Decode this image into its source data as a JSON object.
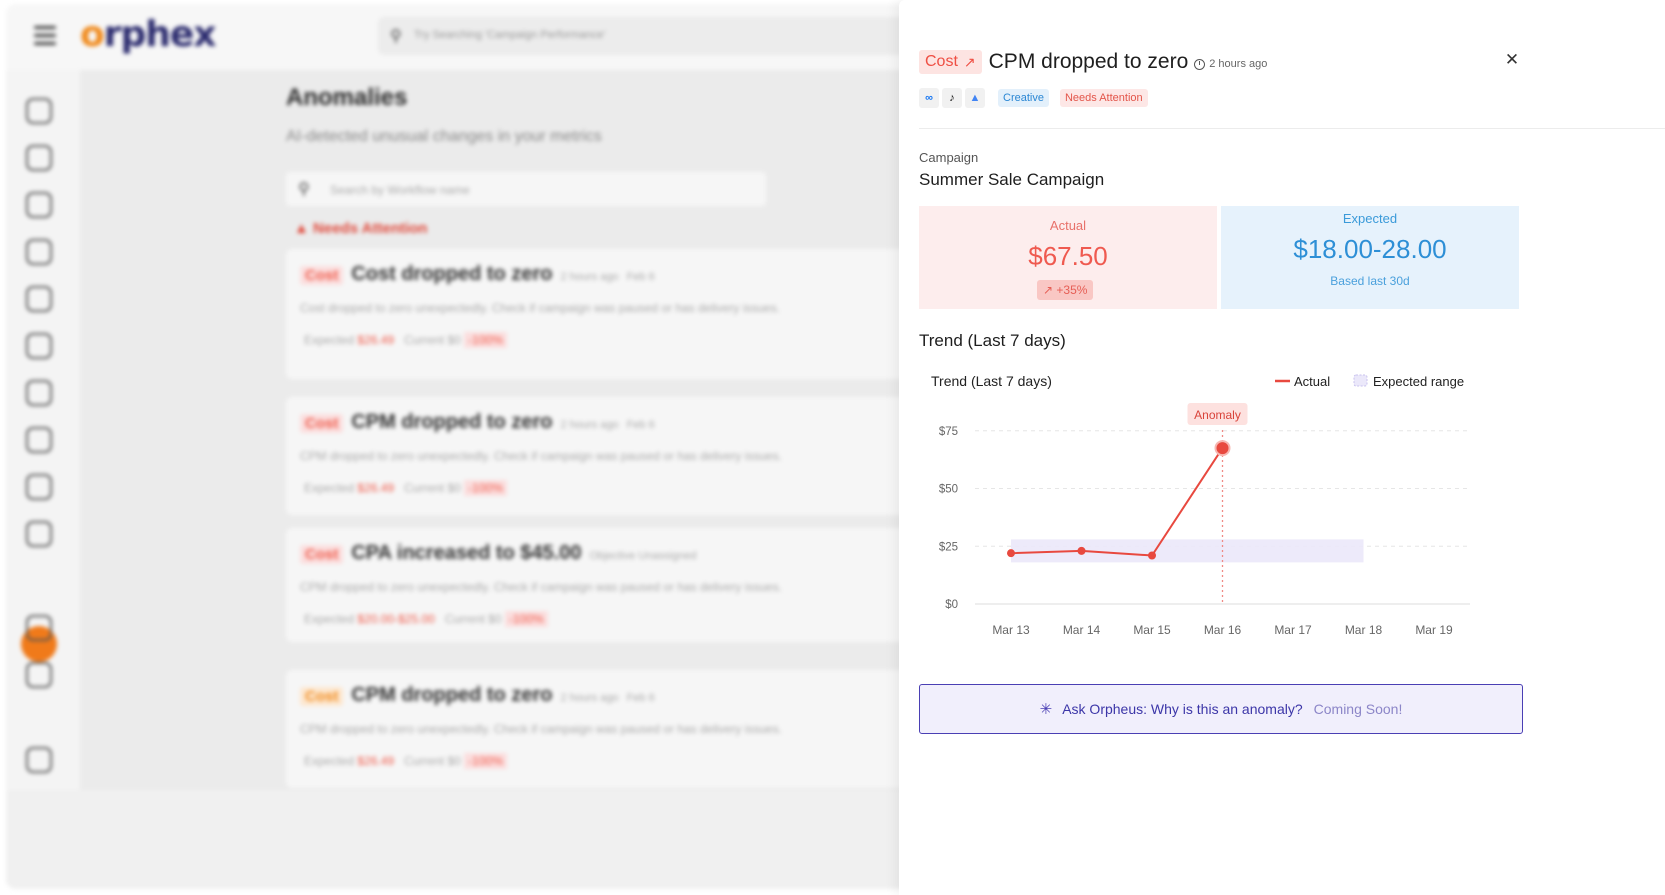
{
  "background_app": {
    "logo": "orphex",
    "search_placeholder": "Try Searching 'Campaign Performance'",
    "page_title": "Anomalies",
    "page_subtitle": "AI-detected unusual changes in your metrics",
    "workflow_search_placeholder": "Search by Workflow name",
    "needs_attention_label": "Needs Attention",
    "cards": [
      {
        "tag": "Cost",
        "title": "Cost dropped to zero",
        "time": "2 hours ago",
        "date": "Feb 6",
        "description": "Cost dropped to zero unexpectedly. Check if campaign was paused or has delivery issues.",
        "expected_label": "Expected",
        "expected_value": "$26.49",
        "current_label": "Current",
        "current_value": "$0",
        "change": "-100%"
      },
      {
        "tag": "Cost",
        "title": "CPM dropped to zero",
        "time": "2 hours ago",
        "date": "Feb 6",
        "description": "CPM dropped to zero unexpectedly. Check if campaign was paused or has delivery issues.",
        "expected_label": "Expected",
        "expected_value": "$26.49",
        "current_label": "Current",
        "current_value": "$0",
        "change": "-100%"
      },
      {
        "tag": "Cost",
        "title": "CPA increased to $45.00",
        "badge": "Objective Unassigned",
        "description": "CPM dropped to zero unexpectedly. Check if campaign was paused or has delivery issues.",
        "expected_label": "Expected",
        "expected_value": "$20.00-$25.00",
        "current_label": "Current",
        "current_value": "$0",
        "change": "-100%"
      },
      {
        "tag": "Cost",
        "title": "CPM dropped to zero",
        "time": "2 hours ago",
        "date": "Feb 6",
        "description": "CPM dropped to zero unexpectedly. Check if campaign was paused or has delivery issues.",
        "expected_label": "Expected",
        "expected_value": "$26.49",
        "current_label": "Current",
        "current_value": "$0",
        "change": "-100%"
      }
    ]
  },
  "panel": {
    "tag": "Cost",
    "tag_icon": "trend-up-icon",
    "title": "CPM dropped to zero",
    "time": "2 hours ago",
    "platforms": [
      "meta-icon",
      "tiktok-icon",
      "google-ads-icon"
    ],
    "badge_creative": "Creative",
    "badge_attention": "Needs Attention",
    "campaign_label": "Campaign",
    "campaign_name": "Summer Sale Campaign",
    "actual_label": "Actual",
    "actual_value": "$67.50",
    "actual_delta": "+35%",
    "expected_label": "Expected",
    "expected_value": "$18.00-28.00",
    "expected_sub": "Based last 30d",
    "trend_heading": "Trend (Last 7 days)",
    "ask_question": "Ask Orpheus: Why is this an anomaly?",
    "ask_soon": "Coming Soon!",
    "colors": {
      "accent_red": "#ef5a50",
      "accent_blue": "#2d8fd6",
      "purple": "#4a3fb4",
      "expected_band": "#ebe8fa"
    }
  },
  "chart_data": {
    "type": "line",
    "title": "Trend (Last 7 days)",
    "categories": [
      "Mar 13",
      "Mar 14",
      "Mar 15",
      "Mar 16",
      "Mar 17",
      "Mar 18",
      "Mar 19"
    ],
    "series": [
      {
        "name": "Actual",
        "values": [
          22,
          23,
          21,
          67.5,
          null,
          null,
          null
        ],
        "color": "#e8493f"
      }
    ],
    "expected_range": {
      "name": "Expected range",
      "low": [
        18,
        18,
        18,
        18,
        18,
        18
      ],
      "high": [
        28,
        28,
        28,
        28,
        28,
        28
      ]
    },
    "anomaly": {
      "label": "Anomaly",
      "category": "Mar 16",
      "value": 67.5
    },
    "yticks": [
      "$0",
      "$25",
      "$50",
      "$75"
    ],
    "ytick_values": [
      0,
      25,
      50,
      75
    ],
    "ylim": [
      0,
      75
    ],
    "legend_actual": "Actual",
    "legend_expected": "Expected range",
    "grid": true,
    "legend_position": "top-right"
  }
}
